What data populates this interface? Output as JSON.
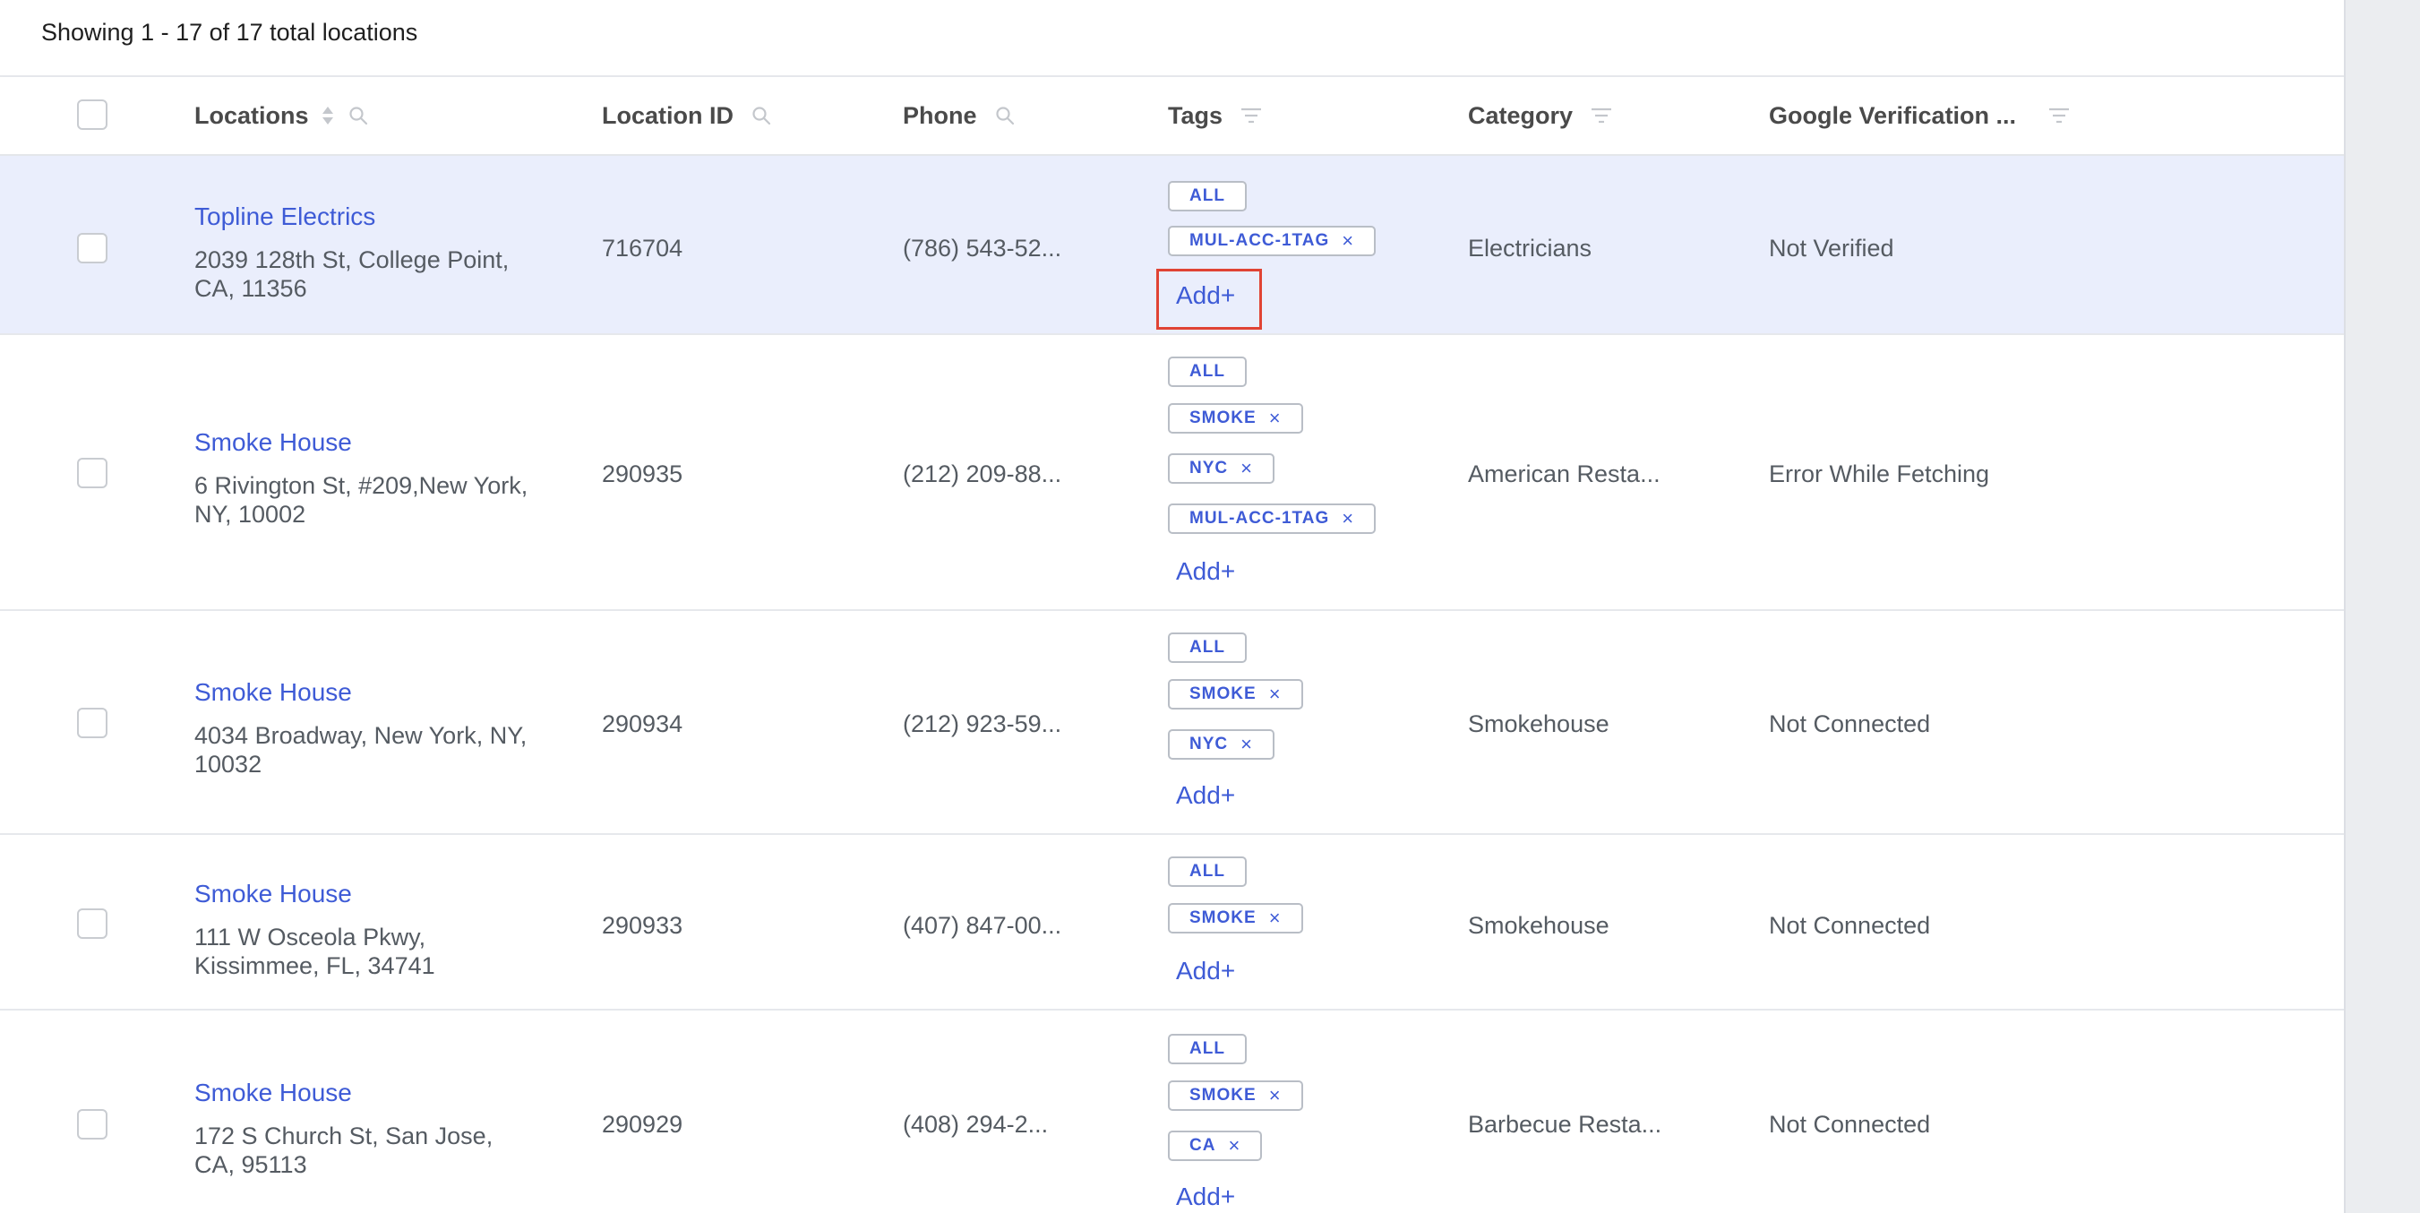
{
  "summary": "Showing 1 - 17 of 17 total locations",
  "columns": {
    "locations": "Locations",
    "location_id": "Location ID",
    "phone": "Phone",
    "tags": "Tags",
    "category": "Category",
    "google_verification": "Google Verification ..."
  },
  "add_label": "Add+",
  "tag_remove": "×",
  "rows": [
    {
      "name": "Topline Electrics",
      "address": "2039 128th St, College Point, CA, 11356",
      "location_id": "716704",
      "phone": "(786) 543-52...",
      "tags": [
        "ALL",
        "MUL-ACC-1TAG"
      ],
      "category": "Electricians",
      "verification": "Not Verified",
      "selected": true
    },
    {
      "name": "Smoke House",
      "address": "6 Rivington St, #209,New York, NY, 10002",
      "location_id": "290935",
      "phone": "(212) 209-88...",
      "tags": [
        "ALL",
        "SMOKE",
        "NYC",
        "MUL-ACC-1TAG"
      ],
      "category": "American Resta...",
      "verification": "Error While Fetching",
      "selected": false
    },
    {
      "name": "Smoke House",
      "address": "4034 Broadway, New York, NY, 10032",
      "location_id": "290934",
      "phone": "(212) 923-59...",
      "tags": [
        "ALL",
        "SMOKE",
        "NYC"
      ],
      "category": "Smokehouse",
      "verification": "Not Connected",
      "selected": false
    },
    {
      "name": "Smoke House",
      "address": "111 W Osceola Pkwy, Kissimmee, FL, 34741",
      "location_id": "290933",
      "phone": "(407) 847-00...",
      "tags": [
        "ALL",
        "SMOKE"
      ],
      "category": "Smokehouse",
      "verification": "Not Connected",
      "selected": false
    },
    {
      "name": "Smoke House",
      "address": "172 S Church St, San Jose, CA, 95113",
      "location_id": "290929",
      "phone": "(408) 294-2...",
      "tags": [
        "ALL",
        "SMOKE",
        "CA"
      ],
      "category": "Barbecue Resta...",
      "verification": "Not Connected",
      "selected": false
    }
  ],
  "colors": {
    "accent": "#3e5bd6",
    "selected_row": "#eaeefc",
    "highlight_box": "#e04334"
  }
}
